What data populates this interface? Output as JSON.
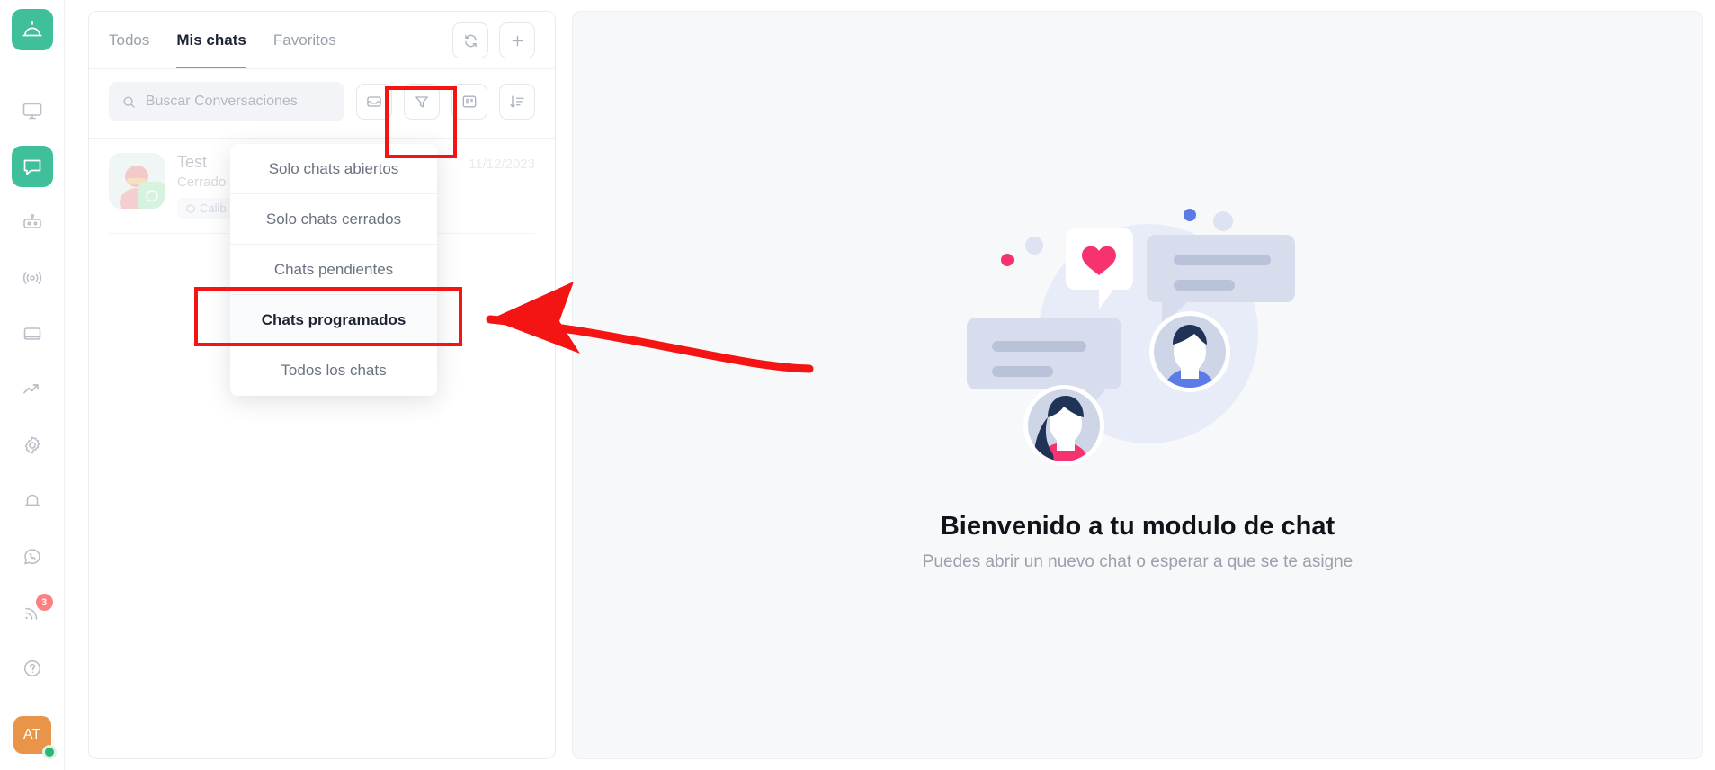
{
  "rail": {
    "logo_icon": "service-bell-icon",
    "items": [
      {
        "icon": "monitor-icon",
        "name": "sidebar-item-dashboard",
        "active": false,
        "badge": ""
      },
      {
        "icon": "chat-icon",
        "name": "sidebar-item-chat",
        "active": true,
        "badge": ""
      },
      {
        "icon": "robot-icon",
        "name": "sidebar-item-bots",
        "active": false,
        "badge": ""
      },
      {
        "icon": "broadcast-icon",
        "name": "sidebar-item-broadcast",
        "active": false,
        "badge": ""
      },
      {
        "icon": "book-icon",
        "name": "sidebar-item-library",
        "active": false,
        "badge": ""
      },
      {
        "icon": "trending-up-icon",
        "name": "sidebar-item-analytics",
        "active": false,
        "badge": ""
      },
      {
        "icon": "gear-icon",
        "name": "sidebar-item-settings",
        "active": false,
        "badge": ""
      },
      {
        "icon": "bell-icon",
        "name": "sidebar-item-notifications",
        "active": false,
        "badge": ""
      },
      {
        "icon": "whatsapp-icon",
        "name": "sidebar-item-whatsapp",
        "active": false,
        "badge": ""
      },
      {
        "icon": "rss-icon",
        "name": "sidebar-item-feed",
        "active": false,
        "badge": "3"
      },
      {
        "icon": "help-icon",
        "name": "sidebar-item-help",
        "active": false,
        "badge": ""
      }
    ],
    "avatar_initials": "AT",
    "avatar_status": "online"
  },
  "list_panel": {
    "tabs": [
      {
        "label": "Todos",
        "active": false
      },
      {
        "label": "Mis chats",
        "active": true
      },
      {
        "label": "Favoritos",
        "active": false
      }
    ],
    "tab_actions": [
      {
        "icon": "refresh-icon",
        "name": "refresh-button"
      },
      {
        "icon": "plus-icon",
        "name": "new-chat-button"
      }
    ],
    "search": {
      "placeholder": "Buscar Conversaciones",
      "value": "",
      "icon": "search-icon"
    },
    "tool_buttons": [
      {
        "icon": "inbox-icon",
        "name": "inbox-filter-button",
        "highlighted": false
      },
      {
        "icon": "funnel-icon",
        "name": "filter-button",
        "highlighted": true
      },
      {
        "icon": "board-icon",
        "name": "board-view-button",
        "highlighted": false
      },
      {
        "icon": "sort-icon",
        "name": "sort-button",
        "highlighted": false
      }
    ],
    "chats": [
      {
        "name": "Test",
        "status": "Cerrado",
        "tag": "Calib",
        "tag_icon": "box-icon",
        "date": "11/12/2023",
        "channel": "whatsapp"
      }
    ]
  },
  "dropdown": {
    "items": [
      {
        "label": "Solo chats abiertos",
        "selected": false
      },
      {
        "label": "Solo chats cerrados",
        "selected": false
      },
      {
        "label": "Chats pendientes",
        "selected": false
      },
      {
        "label": "Chats programados",
        "selected": true
      },
      {
        "label": "Todos los chats",
        "selected": false
      }
    ]
  },
  "right_panel": {
    "illustration": "chat-bubbles-people-illustration",
    "title": "Bienvenido a tu modulo de chat",
    "subtitle": "Puedes abrir un nuevo chat o esperar a que se te asigne"
  },
  "annotations": {
    "highlight_color": "#f41414",
    "boxes": [
      "filter-button",
      "dropdown-item-chats-programados"
    ],
    "arrow": "pointing-left-to-chats-programados"
  },
  "colors": {
    "brand_green": "#3fbf9a",
    "accent_orange": "#e8954a",
    "badge_red": "#ff8080",
    "annotation_red": "#f41414",
    "panel_bg": "#f7f8fa"
  }
}
